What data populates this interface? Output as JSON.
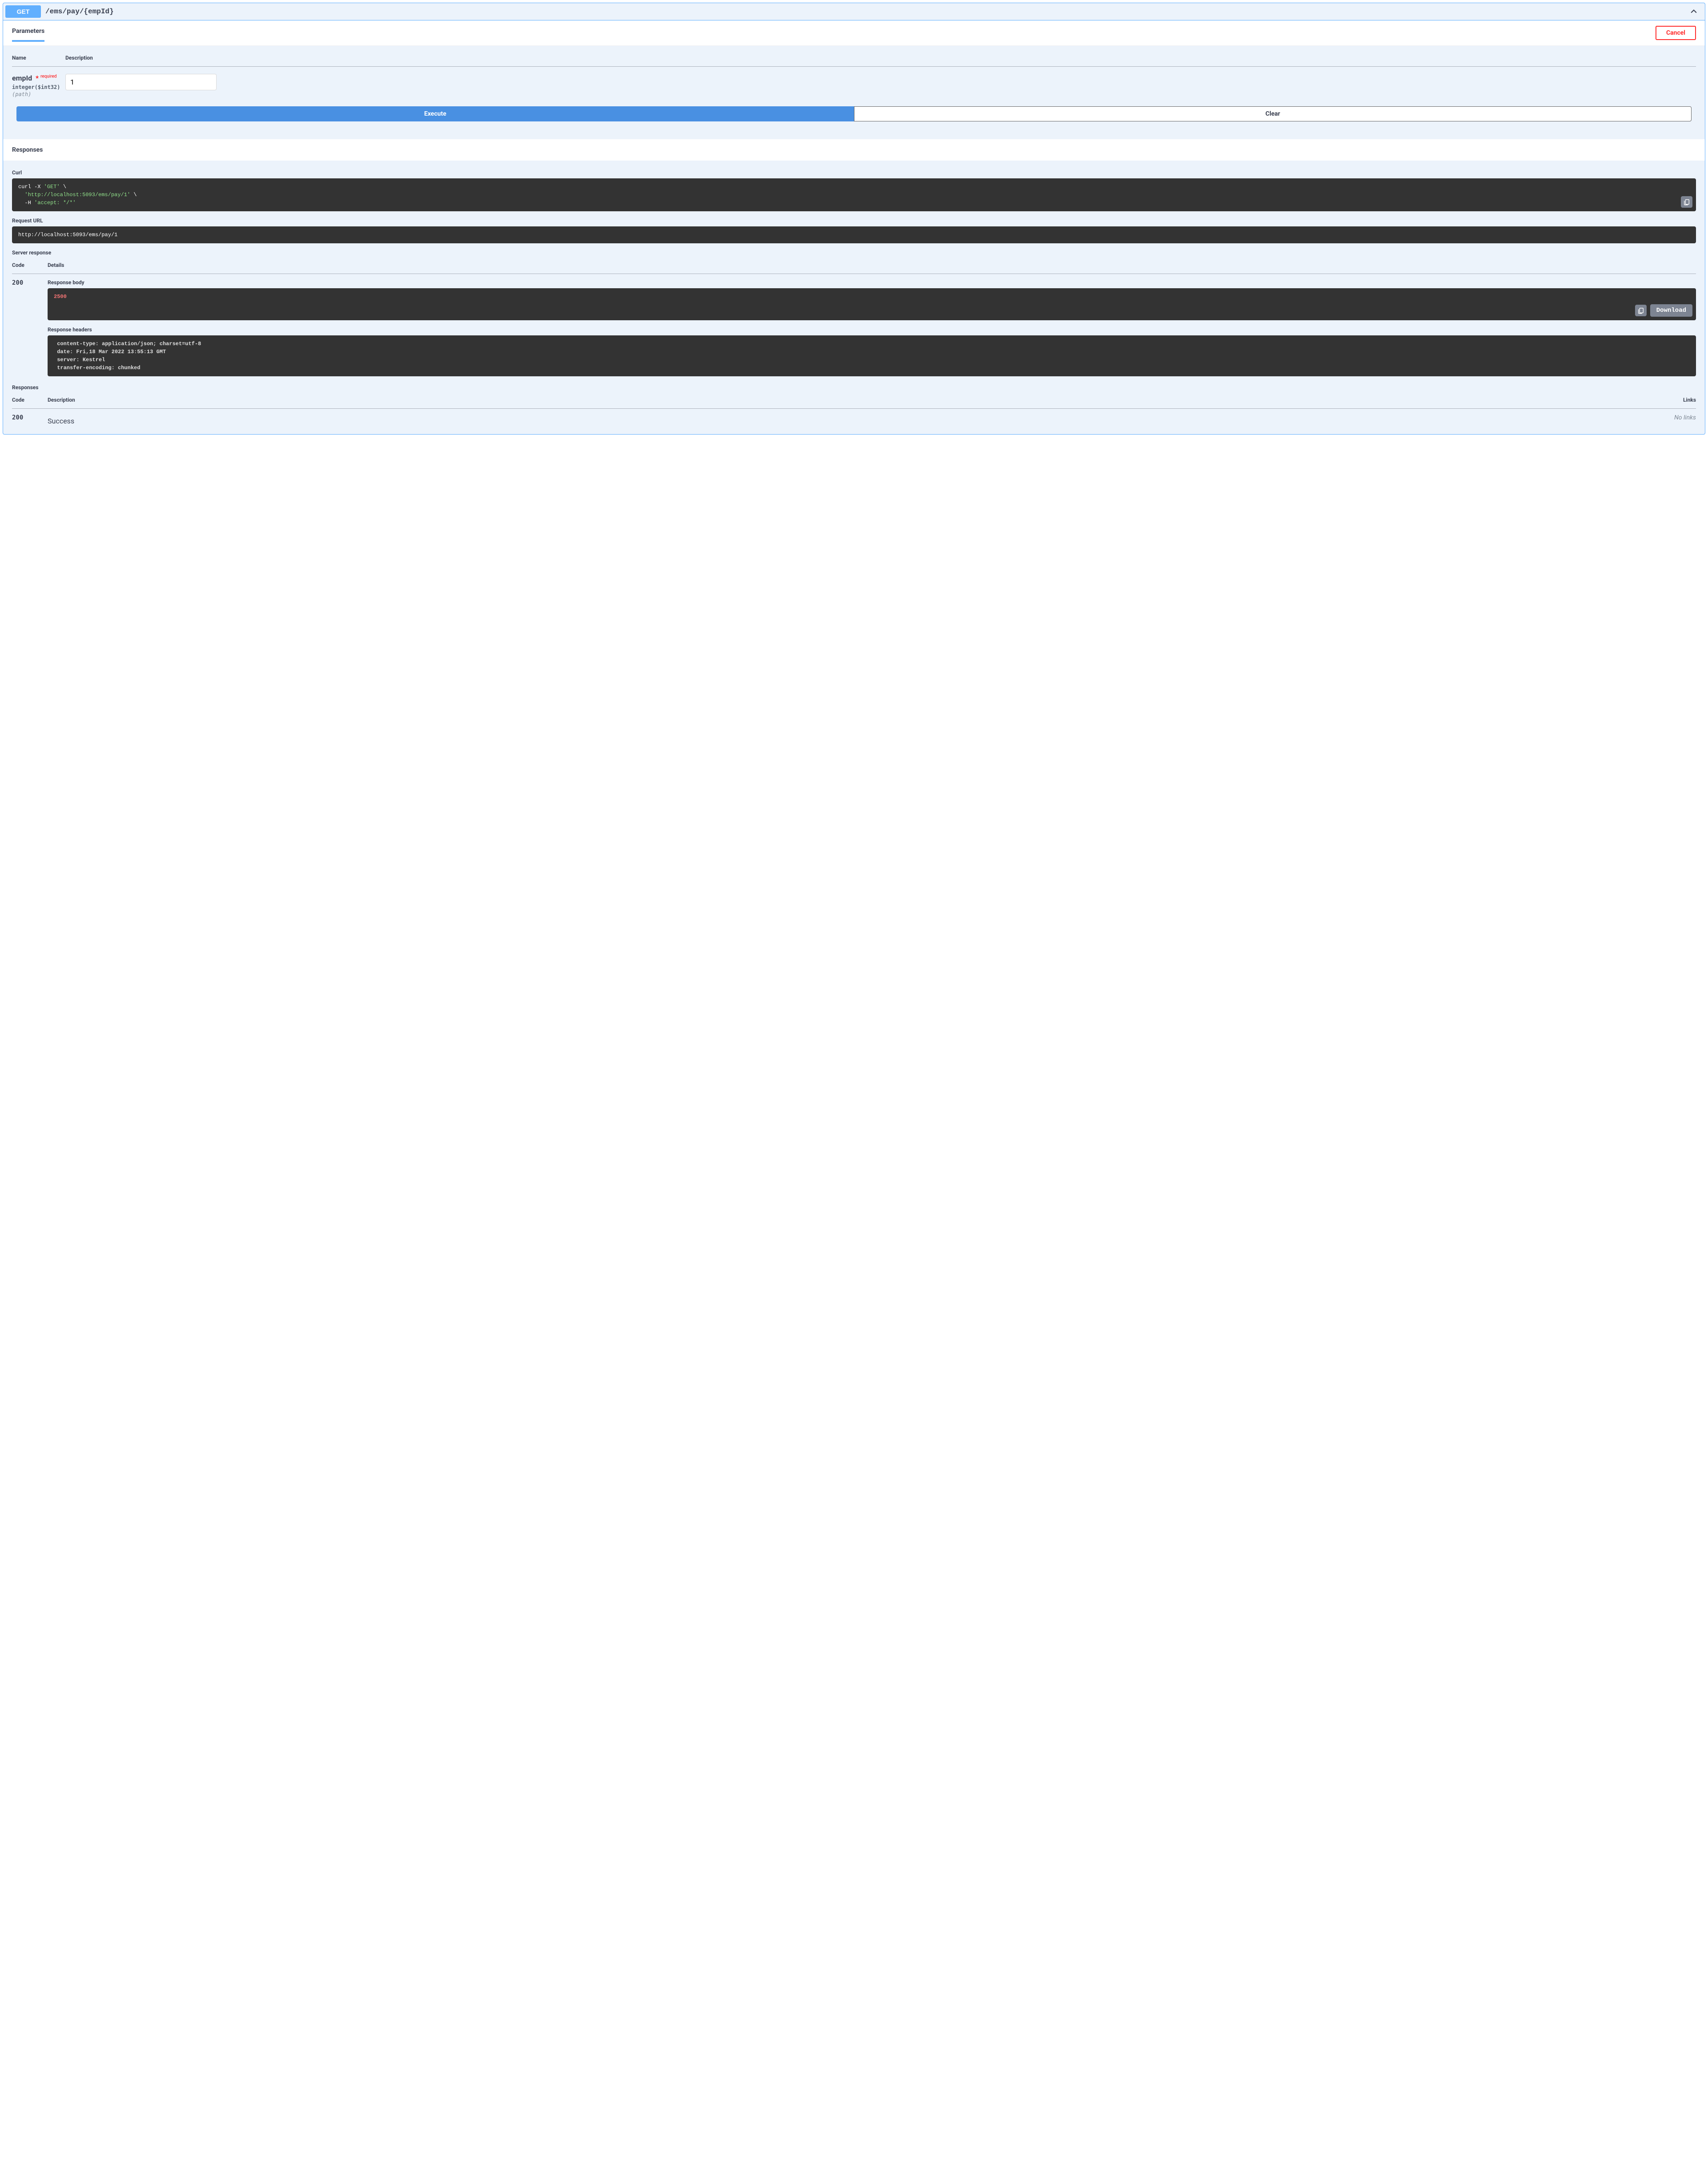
{
  "summary": {
    "method": "GET",
    "path": "/ems/pay/{empId}"
  },
  "tabs": {
    "parameters": "Parameters"
  },
  "buttons": {
    "cancel": "Cancel",
    "execute": "Execute",
    "clear": "Clear",
    "download": "Download"
  },
  "paramHeaders": {
    "name": "Name",
    "description": "Description"
  },
  "param": {
    "name": "empId",
    "required": "required",
    "type": "integer($int32)",
    "in": "(path)",
    "value": "1"
  },
  "responsesTitle": "Responses",
  "curl": {
    "label": "Curl",
    "line1a": "curl -X ",
    "line1b": "'GET'",
    "line1c": " \\",
    "line2a": "  ",
    "line2b": "'http://localhost:5093/ems/pay/1'",
    "line2c": " \\",
    "line3a": "  -H ",
    "line3b": "'accept: */*'"
  },
  "requestUrl": {
    "label": "Request URL",
    "value": "http://localhost:5093/ems/pay/1"
  },
  "serverResponse": {
    "label": "Server response",
    "codeHeader": "Code",
    "detailsHeader": "Details",
    "code": "200",
    "bodyLabel": "Response body",
    "bodyValue": "2500",
    "headersLabel": "Response headers",
    "headersValue": " content-type: application/json; charset=utf-8 \n date: Fri,18 Mar 2022 13:55:13 GMT \n server: Kestrel \n transfer-encoding: chunked "
  },
  "docResponses": {
    "label": "Responses",
    "codeHeader": "Code",
    "descHeader": "Description",
    "linksHeader": "Links",
    "code": "200",
    "desc": "Success",
    "links": "No links"
  }
}
